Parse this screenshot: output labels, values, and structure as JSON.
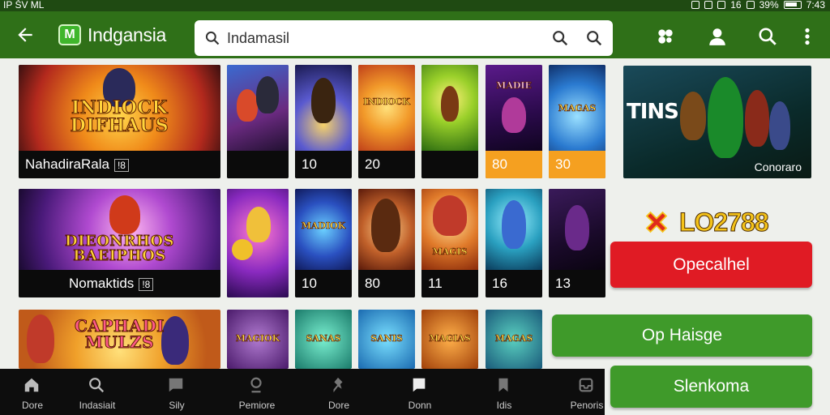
{
  "status": {
    "left": "IP ŠV ML",
    "right_numbers": "16",
    "battery": "39%",
    "time": "7:43"
  },
  "app": {
    "title": "Indgansia",
    "logo_letter": "M"
  },
  "search": {
    "value": "Indamasil",
    "placeholder": "Search"
  },
  "row1": {
    "feature": {
      "title": "INDIOCK DIFHAUS",
      "caption": "NahadiraRala",
      "badge": "!8"
    },
    "tiles": [
      {
        "title": "",
        "caption": ""
      },
      {
        "title": "",
        "caption": "10"
      },
      {
        "title": "INDIOCK",
        "caption": "20"
      },
      {
        "title": "",
        "caption": ""
      },
      {
        "title": "MADIE",
        "caption": "80"
      },
      {
        "title": "MAGAS",
        "caption": "30"
      }
    ]
  },
  "promo": {
    "title": "TINS",
    "caption": "Conoraro"
  },
  "row2": {
    "feature": {
      "title": "DIEONRHOS BAEIPHOS",
      "caption": "Nomaktids",
      "badge": "!8"
    },
    "tiles": [
      {
        "title": "",
        "caption": ""
      },
      {
        "title": "MADIOK",
        "caption": "10"
      },
      {
        "title": "",
        "caption": "80"
      },
      {
        "title": "MAGIS",
        "caption": "11"
      },
      {
        "title": "",
        "caption": "16"
      },
      {
        "title": "",
        "caption": "13"
      }
    ]
  },
  "row3": {
    "feature": {
      "title": "CAPHADI MULZS"
    },
    "tiles": [
      {
        "title": "MAGIOK"
      },
      {
        "title": "SANAS"
      },
      {
        "title": "SANIS"
      },
      {
        "title": "MAGIAS"
      },
      {
        "title": "MAGAS"
      }
    ]
  },
  "score": {
    "value": "LO2788"
  },
  "buttons": {
    "primary": "Opecalhel",
    "secondary": "Op Haisge",
    "tertiary": "Slenkoma"
  },
  "nav": [
    {
      "label": "Dore",
      "icon": "home-icon"
    },
    {
      "label": "Indasiait",
      "icon": "search-icon"
    },
    {
      "label": "Sily",
      "icon": "chat-icon"
    },
    {
      "label": "Pemiore",
      "icon": "profile-icon"
    },
    {
      "label": "Dore",
      "icon": "pin-icon"
    },
    {
      "label": "Donn",
      "icon": "message-icon"
    },
    {
      "label": "Idis",
      "icon": "bookmark-icon"
    },
    {
      "label": "Penoris",
      "icon": "inbox-icon"
    }
  ],
  "colors": {
    "app_bar": "#2f7018",
    "status_bar": "#1f4a12",
    "red_button": "#e01b24",
    "green_button": "#3f9a2a",
    "nav_bg": "#0d0d0d"
  }
}
